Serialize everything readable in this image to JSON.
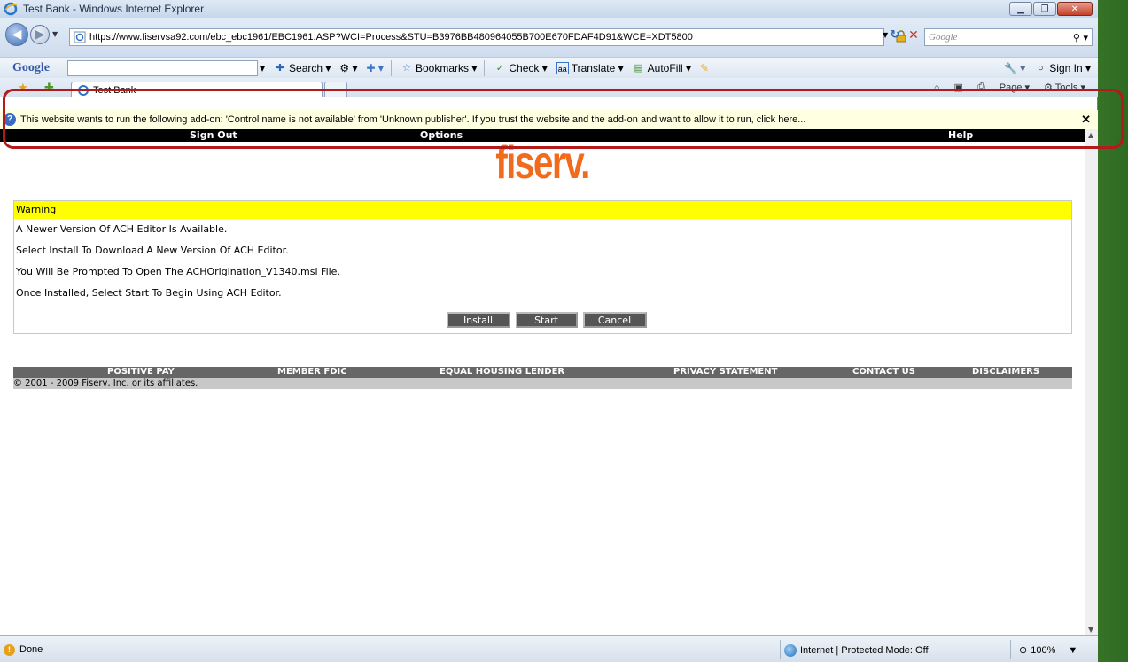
{
  "window": {
    "title": "Test Bank - Windows Internet Explorer"
  },
  "address": {
    "url": "https://www.fiservsa92.com/ebc_ebc1961/EBC1961.ASP?WCI=Process&STU=B3976BB480964055B700E670FDAF4D91&WCE=XDT5800",
    "search_placeholder": "Google"
  },
  "google_toolbar": {
    "logo": "Google",
    "items": [
      "Search",
      "Bookmarks",
      "Check",
      "Translate",
      "AutoFill",
      "Sign In"
    ]
  },
  "tab": {
    "active_label": "Test Bank",
    "tools": [
      "Page",
      "Tools"
    ]
  },
  "infobar": {
    "message": "This website wants to run the following add-on: 'Control name is not available' from 'Unknown publisher'. If you trust the website and the add-on and want to allow it to run, click here..."
  },
  "top_nav": {
    "items": [
      "Sign Out",
      "Options",
      "Help"
    ]
  },
  "logo_text": "fiserv.",
  "warning": {
    "heading": "Warning",
    "lines": [
      "A Newer Version Of ACH Editor Is Available.",
      "Select Install To Download A New Version Of ACH Editor.",
      "You Will Be Prompted To Open The ACHOrigination_V1340.msi File.",
      "Once Installed, Select Start To Begin Using ACH Editor."
    ],
    "buttons": {
      "install": "Install",
      "start": "Start",
      "cancel": "Cancel"
    }
  },
  "footer": {
    "items": [
      "POSITIVE PAY",
      "MEMBER FDIC",
      "EQUAL HOUSING LENDER",
      "PRIVACY STATEMENT",
      "CONTACT US",
      "DISCLAIMERS"
    ],
    "copyright": "© 2001 - 2009 Fiserv, Inc. or its affiliates."
  },
  "status": {
    "text": "Done",
    "zone": "Internet | Protected Mode: Off",
    "zoom": "100%"
  },
  "colors": {
    "brand_orange": "#f26b1d",
    "warning_yellow": "#ffff00",
    "highlight_red": "#b31a1a"
  }
}
